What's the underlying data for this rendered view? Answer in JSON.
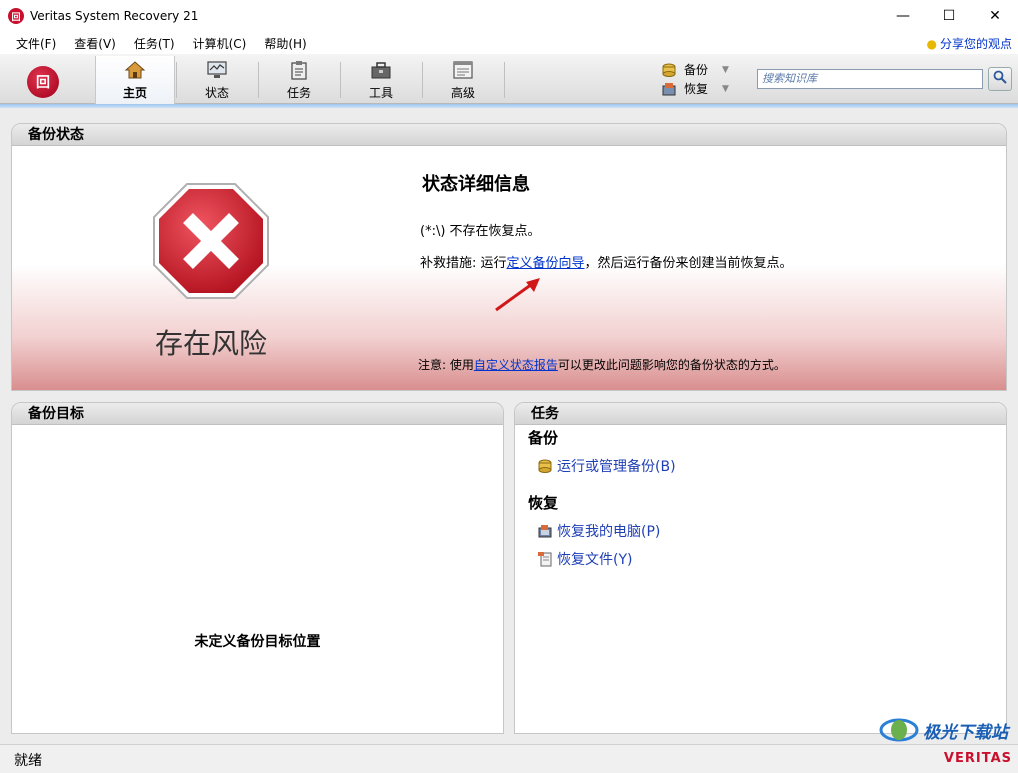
{
  "window": {
    "title": "Veritas System Recovery 21",
    "icon_text": "回"
  },
  "window_controls": {
    "minimize": "—",
    "maximize": "☐",
    "close": "✕"
  },
  "menu": [
    {
      "label": "文件(F)"
    },
    {
      "label": "查看(V)"
    },
    {
      "label": "任务(T)"
    },
    {
      "label": "计算机(C)"
    },
    {
      "label": "帮助(H)"
    }
  ],
  "share": {
    "label": "分享您的观点"
  },
  "toolbar": {
    "logo_text": "回",
    "tabs": [
      {
        "label": "主页",
        "icon": "home-icon",
        "active": true
      },
      {
        "label": "状态",
        "icon": "monitor-icon"
      },
      {
        "label": "任务",
        "icon": "clipboard-icon"
      },
      {
        "label": "工具",
        "icon": "toolbox-icon"
      },
      {
        "label": "高级",
        "icon": "advanced-window-icon"
      }
    ],
    "quick_backup": "备份",
    "quick_restore": "恢复",
    "search_placeholder": "搜索知识库"
  },
  "backup_status": {
    "header": "备份状态",
    "state_label": "存在风险",
    "details_title": "状态详细信息",
    "line1": "(*:\\) 不存在恢复点。",
    "line2_prefix": "补救措施: 运行",
    "line2_link": "定义备份向导",
    "line2_suffix": "，然后运行备份来创建当前恢复点。",
    "note_prefix": "注意: 使用",
    "note_link": "自定义状态报告",
    "note_suffix": "可以更改此问题影响您的备份状态的方式。"
  },
  "backup_target": {
    "header": "备份目标",
    "empty_text": "未定义备份目标位置"
  },
  "tasks": {
    "header": "任务",
    "backup_group": "备份",
    "backup_link": "运行或管理备份(B)",
    "restore_group": "恢复",
    "restore_pc_link": "恢复我的电脑(P)",
    "restore_files_link": "恢复文件(Y)"
  },
  "statusbar": {
    "text": "就绪"
  },
  "watermark": {
    "text": "极光下载站",
    "brand": "VERITAS"
  },
  "colors": {
    "risk_red": "#c8102e",
    "link_blue": "#0033cc",
    "task_blue": "#1f3fb5"
  }
}
